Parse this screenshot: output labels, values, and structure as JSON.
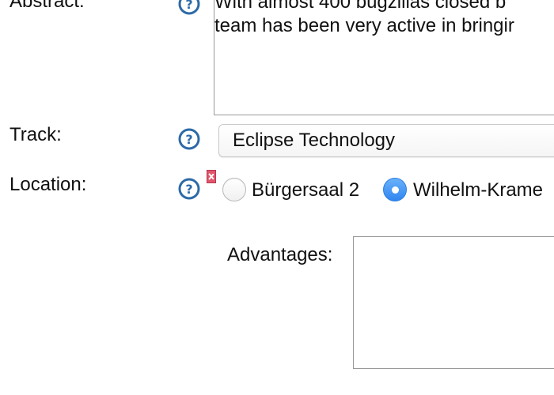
{
  "abstract": {
    "label": "Abstract:",
    "text": "With almost 400 bugzillas closed b\nteam has been very active in bringir"
  },
  "track": {
    "label": "Track:",
    "selected": "Eclipse Technology"
  },
  "location": {
    "label": "Location:",
    "options": [
      "Bürgersaal 2",
      "Wilhelm-Krame"
    ],
    "selected": "Wilhelm-Krame"
  },
  "advantages": {
    "label": "Advantages:",
    "value": ""
  },
  "icons": {
    "help": "help-icon",
    "error": "error-marker-icon"
  },
  "colors": {
    "help_icon": "#2d6aa8",
    "radio_selected": "#3d8ff2",
    "error_marker": "#e0566b"
  }
}
